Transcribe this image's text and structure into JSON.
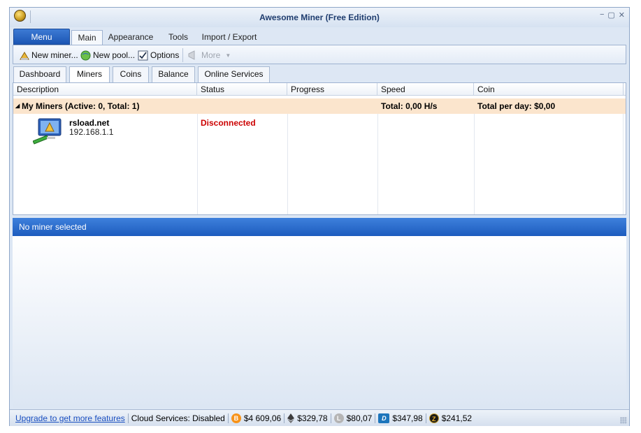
{
  "window": {
    "title": "Awesome Miner (Free Edition)",
    "controls": [
      "minimize",
      "restore",
      "close"
    ]
  },
  "ribbon_tabs": {
    "menu": "Menu",
    "tabs": [
      "Main",
      "Appearance",
      "Tools",
      "Import / Export"
    ],
    "active": "Main"
  },
  "toolbar": {
    "new_miner": "New miner...",
    "new_pool": "New pool...",
    "options": "Options",
    "more": "More"
  },
  "doc_tabs": {
    "tabs": [
      "Dashboard",
      "Miners",
      "Coins",
      "Balance",
      "Online Services"
    ],
    "active": "Miners"
  },
  "grid": {
    "columns": [
      "Description",
      "Status",
      "Progress",
      "Speed",
      "Coin"
    ],
    "group": {
      "label": "My Miners (Active: 0, Total: 1)",
      "speed": "Total: 0,00 H/s",
      "coin": "Total per day: $0,00"
    },
    "miners": [
      {
        "name": "rsload.net",
        "address": "192.168.1.1",
        "status": "Disconnected"
      }
    ]
  },
  "detail": {
    "header": "No miner selected"
  },
  "statusbar": {
    "upgrade": "Upgrade to get more features",
    "cloud": "Cloud Services: Disabled",
    "prices": [
      {
        "coin": "bitcoin",
        "value": "$4 609,06",
        "color": "#f7931a"
      },
      {
        "coin": "ethereum",
        "value": "$329,78",
        "color": "#3c3c3d"
      },
      {
        "coin": "litecoin",
        "value": "$80,07",
        "color": "#b5b5b5"
      },
      {
        "coin": "dash",
        "value": "$347,98",
        "color": "#1c75bc"
      },
      {
        "coin": "zcash",
        "value": "$241,52",
        "color": "#c69c2a"
      }
    ]
  },
  "colors": {
    "accent": "#1d5cbe",
    "group_row": "#fbe5cd",
    "status_error": "#cc0000"
  }
}
